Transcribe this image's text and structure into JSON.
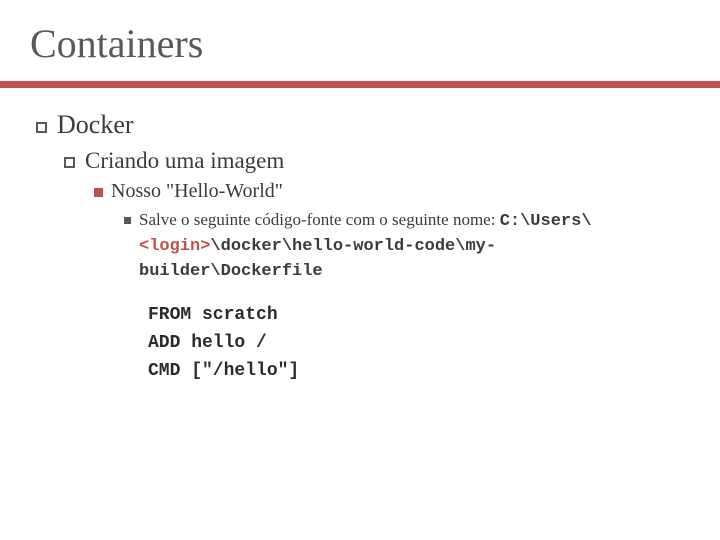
{
  "title": "Containers",
  "lvl1": "Docker",
  "lvl2": "Criando uma imagem",
  "lvl3": "Nosso \"Hello-World\"",
  "lvl4_intro": "Salve o seguinte código-fonte com o seguinte nome: ",
  "path_prefix": "C:\\Users\\",
  "path_login": "<login>",
  "path_suffix": "\\docker\\hello-world-code\\my-builder\\Dockerfile",
  "code_line1": "FROM scratch",
  "code_line2": "ADD hello /",
  "code_line3": "CMD [\"/hello\"]"
}
